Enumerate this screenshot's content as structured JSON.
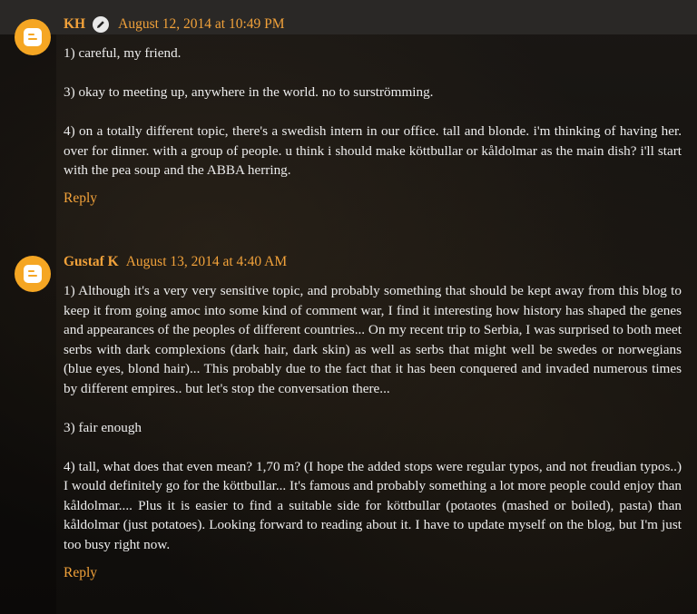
{
  "comments": [
    {
      "author": "KH",
      "date": "August 12, 2014 at 10:49 PM",
      "paragraphs": [
        "1) careful, my friend.",
        "3) okay to meeting up, anywhere in the world. no to surströmming.",
        "4) on a totally different topic, there's a swedish intern in our office. tall and blonde. i'm thinking of having her. over for dinner. with a group of people. u think i should make köttbullar or kåldolmar as the main dish? i'll start with the pea soup and the ABBA herring."
      ],
      "reply": "Reply"
    },
    {
      "author": "Gustaf K",
      "date": "August 13, 2014 at 4:40 AM",
      "paragraphs": [
        "1) Although it's a very very sensitive topic, and probably something that should be kept away from this blog to keep it from going amoc into some kind of comment war, I find it interesting how history has shaped the genes and appearances of the peoples of different countries... On my recent trip to Serbia, I was surprised to both meet serbs with dark complexions (dark hair, dark skin) as well as serbs that might well be swedes or norwegians (blue eyes, blond hair)... This probably due to the fact that it has been conquered and invaded numerous times by different empires.. but let's stop the conversation there...",
        "3) fair enough",
        "4) tall, what does that even mean? 1,70 m? (I hope the added stops were regular typos, and not freudian typos..) I would definitely go for the köttbullar... It's famous and probably something a lot more people could enjoy than kåldolmar.... Plus it is easier to find a suitable side for köttbullar (potaotes (mashed or boiled), pasta) than kåldolmar (just potatoes). Looking forward to reading about it. I have to update myself on the blog, but I'm just too busy right now."
      ],
      "reply": "Reply"
    }
  ],
  "icons": {
    "avatar": "blogger-icon",
    "edit": "pencil-icon"
  },
  "colors": {
    "accent": "#f2a23a",
    "avatar": "#f5a623",
    "text": "#ececec",
    "background": "#141210",
    "topbar": "#2a2826"
  }
}
